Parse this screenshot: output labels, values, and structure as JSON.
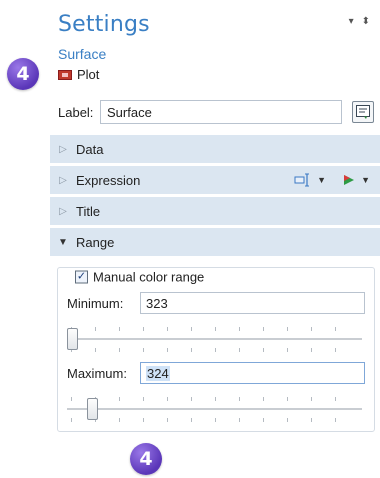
{
  "header": {
    "title": "Settings",
    "node_name": "Surface",
    "node_type": "Plot",
    "tool_menu": "▾",
    "tool_pin": "⬍"
  },
  "badges": {
    "top": "4",
    "bottom": "4"
  },
  "label_field": {
    "label": "Label:",
    "value": "Surface"
  },
  "sections": {
    "data": "Data",
    "expression": "Expression",
    "title": "Title",
    "range": "Range"
  },
  "range": {
    "manual_color_range": {
      "label": "Manual color range",
      "checked": true
    },
    "minimum": {
      "label": "Minimum:",
      "value": "323",
      "slider_position": 0.0
    },
    "maximum": {
      "label": "Maximum:",
      "value": "324",
      "slider_position": 0.07
    }
  },
  "colors": {
    "title_blue": "#3a7fc4",
    "section_bg": "#dbe6f1",
    "badge_purple": "#5a36b8"
  }
}
